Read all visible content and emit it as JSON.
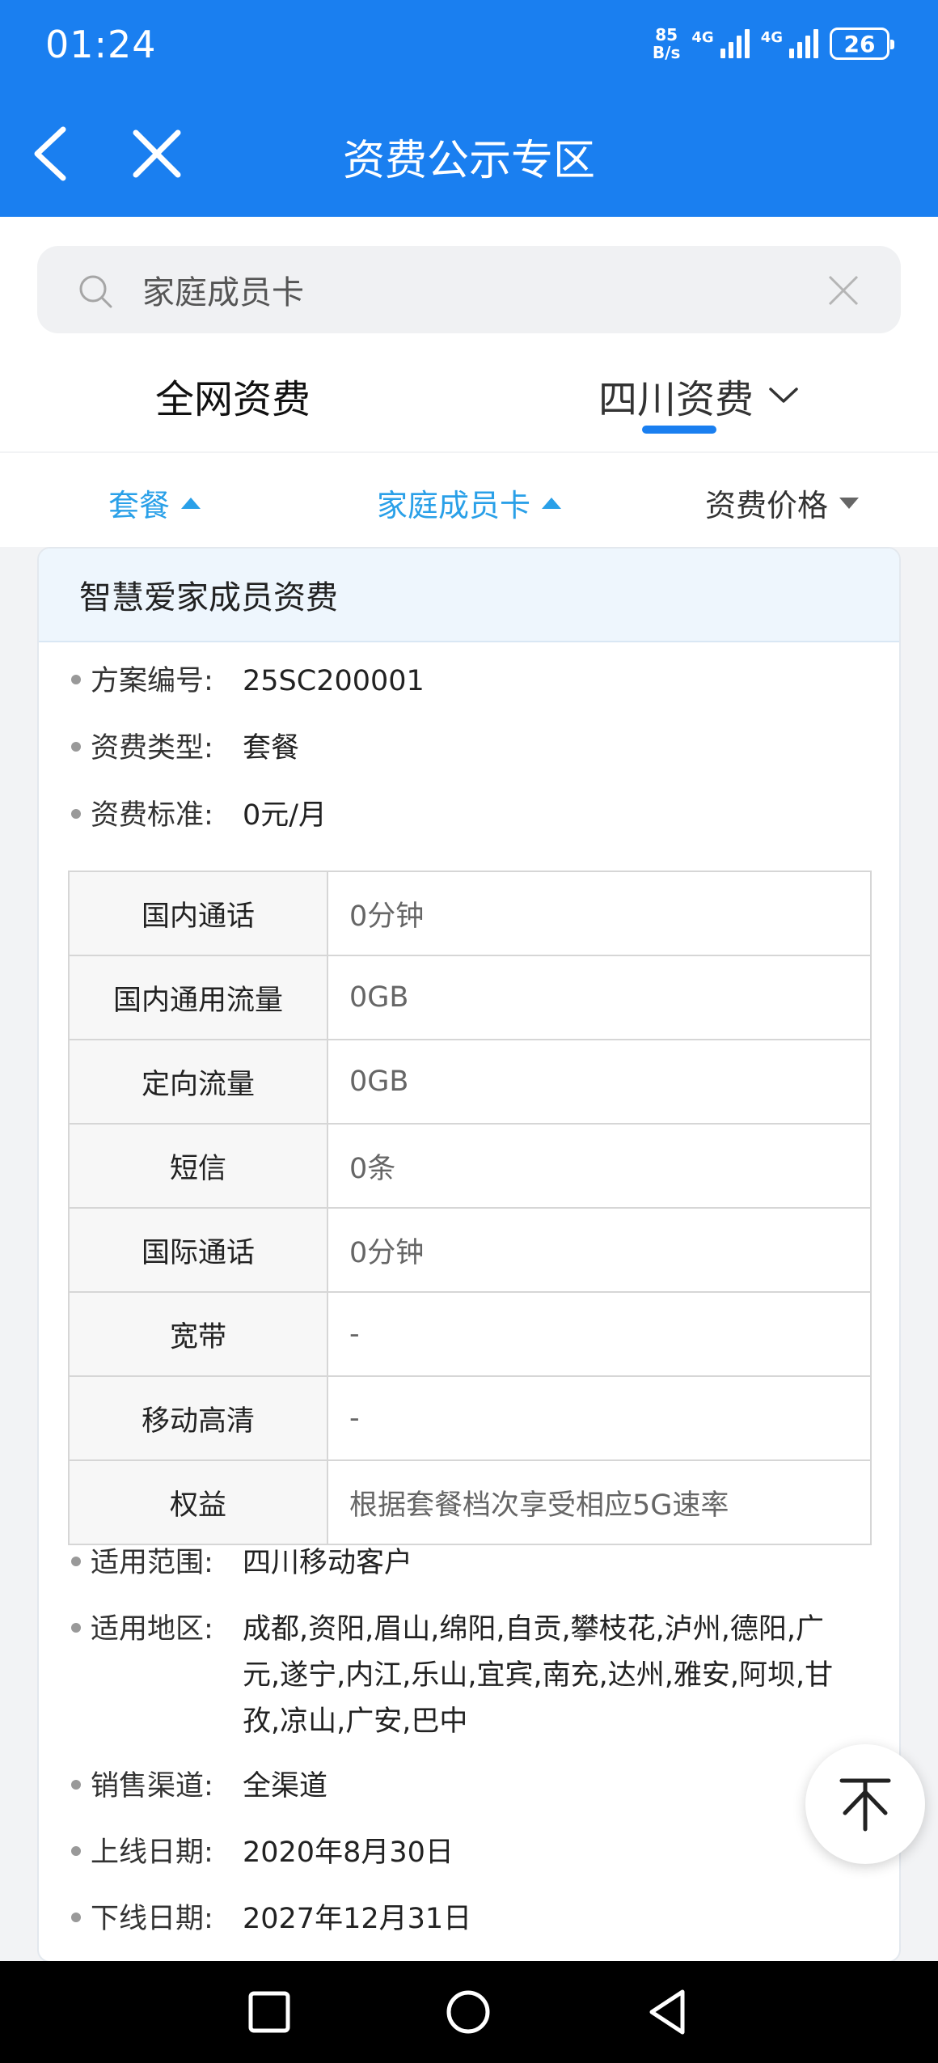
{
  "status_bar": {
    "time": "01:24",
    "net_speed_value": "85",
    "net_speed_unit": "B/s",
    "signal1_label": "4G",
    "signal2_label": "4G",
    "battery": "26"
  },
  "header": {
    "title": "资费公示专区",
    "back_icon": "chevron-left-icon",
    "close_icon": "close-icon"
  },
  "search": {
    "value": "家庭成员卡"
  },
  "region_tabs": {
    "all": "全网资费",
    "sichuan": "四川资费",
    "active": "sichuan"
  },
  "filters": [
    {
      "label": "套餐",
      "state": "active"
    },
    {
      "label": "家庭成员卡",
      "state": "active"
    },
    {
      "label": "资费价格",
      "state": "inactive"
    }
  ],
  "card": {
    "title": "智慧爱家成员资费",
    "top_info": [
      {
        "key": "方案编号:",
        "value": "25SC200001"
      },
      {
        "key": "资费类型:",
        "value": "套餐"
      },
      {
        "key": "资费标准:",
        "value": "0元/月"
      }
    ],
    "spec_table": [
      {
        "label": "国内通话",
        "value": "0分钟"
      },
      {
        "label": "国内通用流量",
        "value": "0GB"
      },
      {
        "label": "定向流量",
        "value": "0GB"
      },
      {
        "label": "短信",
        "value": "0条"
      },
      {
        "label": "国际通话",
        "value": "0分钟"
      },
      {
        "label": "宽带",
        "value": "-"
      },
      {
        "label": "移动高清",
        "value": "-"
      },
      {
        "label": "权益",
        "value": "根据套餐档次享受相应5G速率"
      }
    ],
    "bottom_info": [
      {
        "key": "适用范围:",
        "value": "四川移动客户"
      },
      {
        "key": "适用地区:",
        "value": "成都,资阳,眉山,绵阳,自贡,攀枝花,泸州,德阳,广元,遂宁,内江,乐山,宜宾,南充,达州,雅安,阿坝,甘孜,凉山,广安,巴中"
      },
      {
        "key": "销售渠道:",
        "value": "全渠道"
      },
      {
        "key": "上线日期:",
        "value": "2020年8月30日"
      },
      {
        "key": "下线日期:",
        "value": "2027年12月31日"
      }
    ]
  },
  "colors": {
    "header_blue": "#1a7ff0",
    "active_filter": "#2aa0e8",
    "card_head_bg": "#eef6fd"
  }
}
